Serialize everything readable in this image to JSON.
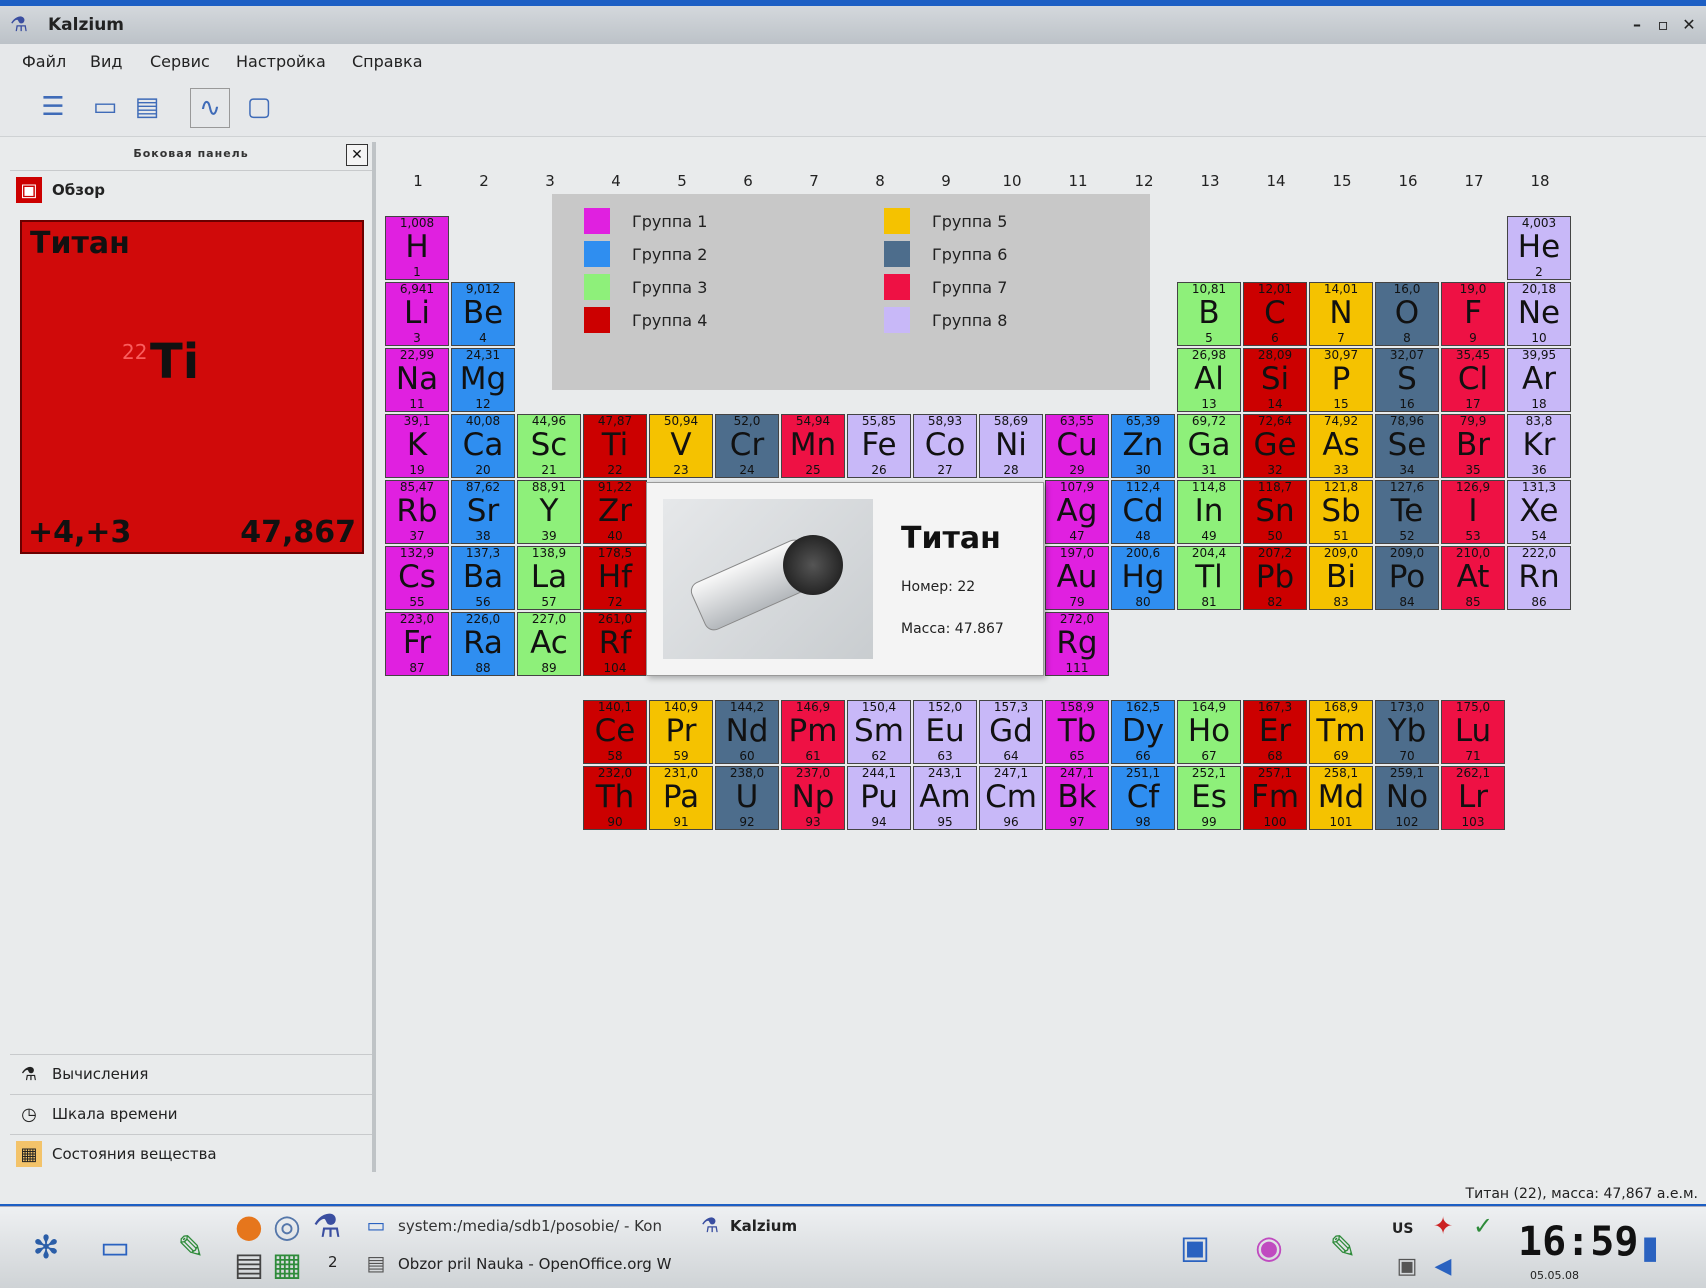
{
  "window": {
    "title": "Kalzium"
  },
  "menu": [
    "Файл",
    "Вид",
    "Сервис",
    "Настройка",
    "Справка"
  ],
  "sidebar": {
    "header": "Боковая панель",
    "tabs": [
      {
        "label": "Обзор"
      },
      {
        "label": "Вычисления"
      },
      {
        "label": "Шкала времени"
      },
      {
        "label": "Состояния вещества"
      }
    ]
  },
  "element_card": {
    "name": "Титан",
    "number": "22",
    "symbol": "Ti",
    "oxidation": "+4,+3",
    "mass": "47,867"
  },
  "group_numbers": [
    "1",
    "2",
    "3",
    "4",
    "5",
    "6",
    "7",
    "8",
    "9",
    "10",
    "11",
    "12",
    "13",
    "14",
    "15",
    "16",
    "17",
    "18"
  ],
  "legend": [
    {
      "label": "Группа 1",
      "color": "#e020e0"
    },
    {
      "label": "Группа 2",
      "color": "#2f8ef0"
    },
    {
      "label": "Группа 3",
      "color": "#8ef07a"
    },
    {
      "label": "Группа 4",
      "color": "#cc0000"
    },
    {
      "label": "Группа 5",
      "color": "#f5c200"
    },
    {
      "label": "Группа 6",
      "color": "#4d6d8c"
    },
    {
      "label": "Группа 7",
      "color": "#ee1144"
    },
    {
      "label": "Группа 8",
      "color": "#c8b8f8"
    }
  ],
  "elements": [
    {
      "s": "H",
      "n": "1",
      "m": "1,008",
      "g": 1,
      "r": 1,
      "c": 1
    },
    {
      "s": "He",
      "n": "2",
      "m": "4,003",
      "g": 8,
      "r": 1,
      "c": 18
    },
    {
      "s": "Li",
      "n": "3",
      "m": "6,941",
      "g": 1,
      "r": 2,
      "c": 1
    },
    {
      "s": "Be",
      "n": "4",
      "m": "9,012",
      "g": 2,
      "r": 2,
      "c": 2
    },
    {
      "s": "B",
      "n": "5",
      "m": "10,81",
      "g": 3,
      "r": 2,
      "c": 13
    },
    {
      "s": "C",
      "n": "6",
      "m": "12,01",
      "g": 4,
      "r": 2,
      "c": 14
    },
    {
      "s": "N",
      "n": "7",
      "m": "14,01",
      "g": 5,
      "r": 2,
      "c": 15
    },
    {
      "s": "O",
      "n": "8",
      "m": "16,0",
      "g": 6,
      "r": 2,
      "c": 16
    },
    {
      "s": "F",
      "n": "9",
      "m": "19,0",
      "g": 7,
      "r": 2,
      "c": 17
    },
    {
      "s": "Ne",
      "n": "10",
      "m": "20,18",
      "g": 8,
      "r": 2,
      "c": 18
    },
    {
      "s": "Na",
      "n": "11",
      "m": "22,99",
      "g": 1,
      "r": 3,
      "c": 1
    },
    {
      "s": "Mg",
      "n": "12",
      "m": "24,31",
      "g": 2,
      "r": 3,
      "c": 2
    },
    {
      "s": "Al",
      "n": "13",
      "m": "26,98",
      "g": 3,
      "r": 3,
      "c": 13
    },
    {
      "s": "Si",
      "n": "14",
      "m": "28,09",
      "g": 4,
      "r": 3,
      "c": 14
    },
    {
      "s": "P",
      "n": "15",
      "m": "30,97",
      "g": 5,
      "r": 3,
      "c": 15
    },
    {
      "s": "S",
      "n": "16",
      "m": "32,07",
      "g": 6,
      "r": 3,
      "c": 16
    },
    {
      "s": "Cl",
      "n": "17",
      "m": "35,45",
      "g": 7,
      "r": 3,
      "c": 17
    },
    {
      "s": "Ar",
      "n": "18",
      "m": "39,95",
      "g": 8,
      "r": 3,
      "c": 18
    },
    {
      "s": "K",
      "n": "19",
      "m": "39,1",
      "g": 1,
      "r": 4,
      "c": 1
    },
    {
      "s": "Ca",
      "n": "20",
      "m": "40,08",
      "g": 2,
      "r": 4,
      "c": 2
    },
    {
      "s": "Sc",
      "n": "21",
      "m": "44,96",
      "g": 3,
      "r": 4,
      "c": 3
    },
    {
      "s": "Ti",
      "n": "22",
      "m": "47,87",
      "g": 4,
      "r": 4,
      "c": 4
    },
    {
      "s": "V",
      "n": "23",
      "m": "50,94",
      "g": 5,
      "r": 4,
      "c": 5
    },
    {
      "s": "Cr",
      "n": "24",
      "m": "52,0",
      "g": 6,
      "r": 4,
      "c": 6
    },
    {
      "s": "Mn",
      "n": "25",
      "m": "54,94",
      "g": 7,
      "r": 4,
      "c": 7
    },
    {
      "s": "Fe",
      "n": "26",
      "m": "55,85",
      "g": 8,
      "r": 4,
      "c": 8
    },
    {
      "s": "Co",
      "n": "27",
      "m": "58,93",
      "g": 8,
      "r": 4,
      "c": 9
    },
    {
      "s": "Ni",
      "n": "28",
      "m": "58,69",
      "g": 8,
      "r": 4,
      "c": 10
    },
    {
      "s": "Cu",
      "n": "29",
      "m": "63,55",
      "g": 1,
      "r": 4,
      "c": 11
    },
    {
      "s": "Zn",
      "n": "30",
      "m": "65,39",
      "g": 2,
      "r": 4,
      "c": 12
    },
    {
      "s": "Ga",
      "n": "31",
      "m": "69,72",
      "g": 3,
      "r": 4,
      "c": 13
    },
    {
      "s": "Ge",
      "n": "32",
      "m": "72,64",
      "g": 4,
      "r": 4,
      "c": 14
    },
    {
      "s": "As",
      "n": "33",
      "m": "74,92",
      "g": 5,
      "r": 4,
      "c": 15
    },
    {
      "s": "Se",
      "n": "34",
      "m": "78,96",
      "g": 6,
      "r": 4,
      "c": 16
    },
    {
      "s": "Br",
      "n": "35",
      "m": "79,9",
      "g": 7,
      "r": 4,
      "c": 17
    },
    {
      "s": "Kr",
      "n": "36",
      "m": "83,8",
      "g": 8,
      "r": 4,
      "c": 18
    },
    {
      "s": "Rb",
      "n": "37",
      "m": "85,47",
      "g": 1,
      "r": 5,
      "c": 1
    },
    {
      "s": "Sr",
      "n": "38",
      "m": "87,62",
      "g": 2,
      "r": 5,
      "c": 2
    },
    {
      "s": "Y",
      "n": "39",
      "m": "88,91",
      "g": 3,
      "r": 5,
      "c": 3
    },
    {
      "s": "Zr",
      "n": "40",
      "m": "91,22",
      "g": 4,
      "r": 5,
      "c": 4
    },
    {
      "s": "Ag",
      "n": "47",
      "m": "107,9",
      "g": 1,
      "r": 5,
      "c": 11
    },
    {
      "s": "Cd",
      "n": "48",
      "m": "112,4",
      "g": 2,
      "r": 5,
      "c": 12
    },
    {
      "s": "In",
      "n": "49",
      "m": "114,8",
      "g": 3,
      "r": 5,
      "c": 13
    },
    {
      "s": "Sn",
      "n": "50",
      "m": "118,7",
      "g": 4,
      "r": 5,
      "c": 14
    },
    {
      "s": "Sb",
      "n": "51",
      "m": "121,8",
      "g": 5,
      "r": 5,
      "c": 15
    },
    {
      "s": "Te",
      "n": "52",
      "m": "127,6",
      "g": 6,
      "r": 5,
      "c": 16
    },
    {
      "s": "I",
      "n": "53",
      "m": "126,9",
      "g": 7,
      "r": 5,
      "c": 17
    },
    {
      "s": "Xe",
      "n": "54",
      "m": "131,3",
      "g": 8,
      "r": 5,
      "c": 18
    },
    {
      "s": "Cs",
      "n": "55",
      "m": "132,9",
      "g": 1,
      "r": 6,
      "c": 1
    },
    {
      "s": "Ba",
      "n": "56",
      "m": "137,3",
      "g": 2,
      "r": 6,
      "c": 2
    },
    {
      "s": "La",
      "n": "57",
      "m": "138,9",
      "g": 3,
      "r": 6,
      "c": 3
    },
    {
      "s": "Hf",
      "n": "72",
      "m": "178,5",
      "g": 4,
      "r": 6,
      "c": 4
    },
    {
      "s": "Au",
      "n": "79",
      "m": "197,0",
      "g": 1,
      "r": 6,
      "c": 11
    },
    {
      "s": "Hg",
      "n": "80",
      "m": "200,6",
      "g": 2,
      "r": 6,
      "c": 12
    },
    {
      "s": "Tl",
      "n": "81",
      "m": "204,4",
      "g": 3,
      "r": 6,
      "c": 13
    },
    {
      "s": "Pb",
      "n": "82",
      "m": "207,2",
      "g": 4,
      "r": 6,
      "c": 14
    },
    {
      "s": "Bi",
      "n": "83",
      "m": "209,0",
      "g": 5,
      "r": 6,
      "c": 15
    },
    {
      "s": "Po",
      "n": "84",
      "m": "209,0",
      "g": 6,
      "r": 6,
      "c": 16
    },
    {
      "s": "At",
      "n": "85",
      "m": "210,0",
      "g": 7,
      "r": 6,
      "c": 17
    },
    {
      "s": "Rn",
      "n": "86",
      "m": "222,0",
      "g": 8,
      "r": 6,
      "c": 18
    },
    {
      "s": "Fr",
      "n": "87",
      "m": "223,0",
      "g": 1,
      "r": 7,
      "c": 1
    },
    {
      "s": "Ra",
      "n": "88",
      "m": "226,0",
      "g": 2,
      "r": 7,
      "c": 2
    },
    {
      "s": "Ac",
      "n": "89",
      "m": "227,0",
      "g": 3,
      "r": 7,
      "c": 3
    },
    {
      "s": "Rf",
      "n": "104",
      "m": "261,0",
      "g": 4,
      "r": 7,
      "c": 4
    },
    {
      "s": "Rg",
      "n": "111",
      "m": "272,0",
      "g": 1,
      "r": 7,
      "c": 11
    },
    {
      "s": "Ce",
      "n": "58",
      "m": "140,1",
      "g": 4,
      "r": 8,
      "c": 4
    },
    {
      "s": "Pr",
      "n": "59",
      "m": "140,9",
      "g": 5,
      "r": 8,
      "c": 5
    },
    {
      "s": "Nd",
      "n": "60",
      "m": "144,2",
      "g": 6,
      "r": 8,
      "c": 6
    },
    {
      "s": "Pm",
      "n": "61",
      "m": "146,9",
      "g": 7,
      "r": 8,
      "c": 7
    },
    {
      "s": "Sm",
      "n": "62",
      "m": "150,4",
      "g": 8,
      "r": 8,
      "c": 8
    },
    {
      "s": "Eu",
      "n": "63",
      "m": "152,0",
      "g": 8,
      "r": 8,
      "c": 9
    },
    {
      "s": "Gd",
      "n": "64",
      "m": "157,3",
      "g": 8,
      "r": 8,
      "c": 10
    },
    {
      "s": "Tb",
      "n": "65",
      "m": "158,9",
      "g": 1,
      "r": 8,
      "c": 11
    },
    {
      "s": "Dy",
      "n": "66",
      "m": "162,5",
      "g": 2,
      "r": 8,
      "c": 12
    },
    {
      "s": "Ho",
      "n": "67",
      "m": "164,9",
      "g": 3,
      "r": 8,
      "c": 13
    },
    {
      "s": "Er",
      "n": "68",
      "m": "167,3",
      "g": 4,
      "r": 8,
      "c": 14
    },
    {
      "s": "Tm",
      "n": "69",
      "m": "168,9",
      "g": 5,
      "r": 8,
      "c": 15
    },
    {
      "s": "Yb",
      "n": "70",
      "m": "173,0",
      "g": 6,
      "r": 8,
      "c": 16
    },
    {
      "s": "Lu",
      "n": "71",
      "m": "175,0",
      "g": 7,
      "r": 8,
      "c": 17
    },
    {
      "s": "Th",
      "n": "90",
      "m": "232,0",
      "g": 4,
      "r": 9,
      "c": 4
    },
    {
      "s": "Pa",
      "n": "91",
      "m": "231,0",
      "g": 5,
      "r": 9,
      "c": 5
    },
    {
      "s": "U",
      "n": "92",
      "m": "238,0",
      "g": 6,
      "r": 9,
      "c": 6
    },
    {
      "s": "Np",
      "n": "93",
      "m": "237,0",
      "g": 7,
      "r": 9,
      "c": 7
    },
    {
      "s": "Pu",
      "n": "94",
      "m": "244,1",
      "g": 8,
      "r": 9,
      "c": 8
    },
    {
      "s": "Am",
      "n": "95",
      "m": "243,1",
      "g": 8,
      "r": 9,
      "c": 9
    },
    {
      "s": "Cm",
      "n": "96",
      "m": "247,1",
      "g": 8,
      "r": 9,
      "c": 10
    },
    {
      "s": "Bk",
      "n": "97",
      "m": "247,1",
      "g": 1,
      "r": 9,
      "c": 11
    },
    {
      "s": "Cf",
      "n": "98",
      "m": "251,1",
      "g": 2,
      "r": 9,
      "c": 12
    },
    {
      "s": "Es",
      "n": "99",
      "m": "252,1",
      "g": 3,
      "r": 9,
      "c": 13
    },
    {
      "s": "Fm",
      "n": "100",
      "m": "257,1",
      "g": 4,
      "r": 9,
      "c": 14
    },
    {
      "s": "Md",
      "n": "101",
      "m": "258,1",
      "g": 5,
      "r": 9,
      "c": 15
    },
    {
      "s": "No",
      "n": "102",
      "m": "259,1",
      "g": 6,
      "r": 9,
      "c": 16
    },
    {
      "s": "Lr",
      "n": "103",
      "m": "262,1",
      "g": 7,
      "r": 9,
      "c": 17
    }
  ],
  "tooltip": {
    "name": "Титан",
    "number": "Номер: 22",
    "mass": "Масса: 47.867"
  },
  "statusbar": "Титан (22), масса: 47,867 а.е.м.",
  "taskbar": {
    "task1": "system:/media/sdb1/posobie/ - Kon",
    "task2": "Kalzium",
    "task3": "Obzor pril Nauka - OpenOffice.org W",
    "desktop_num": "2",
    "kbd": "US",
    "clock": "16:59",
    "date": "05.05.08"
  }
}
